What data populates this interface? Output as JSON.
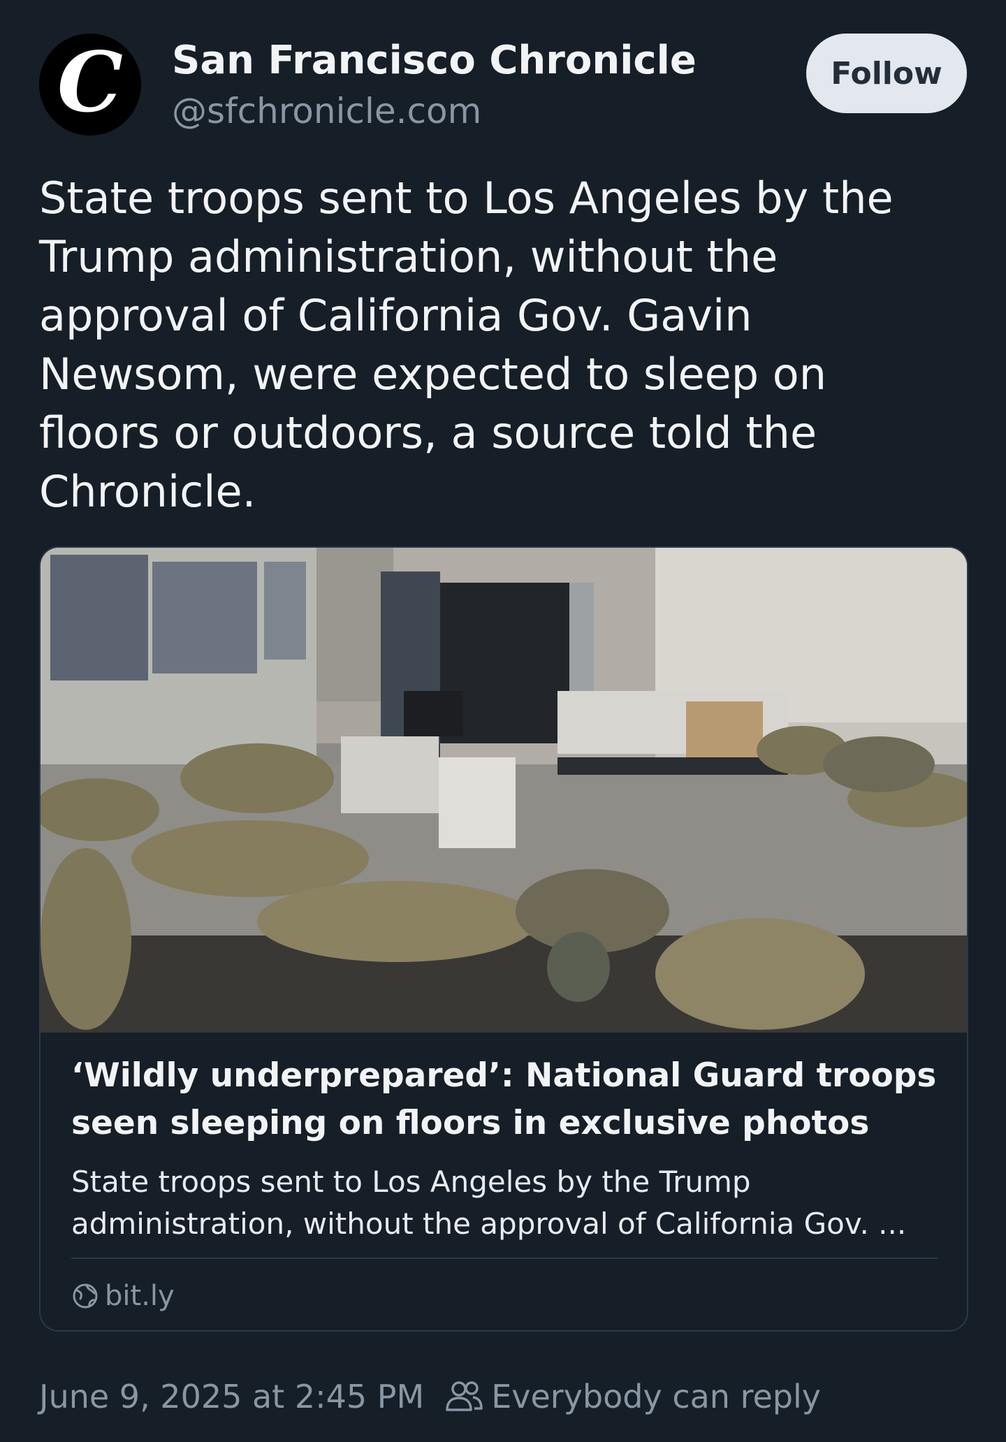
{
  "author": {
    "avatar_letter": "C",
    "display_name": "San Francisco Chronicle",
    "handle": "@sfchronicle.com"
  },
  "follow_label": "Follow",
  "post": {
    "text": "State troops sent to Los Angeles by the Trump administration, without the approval of California Gov. Gavin Newsom, were expected to sleep on floors or outdoors, a source told the Chronicle."
  },
  "link_card": {
    "title": "‘Wildly underprepared’: National Guard troops seen sleeping on floors in exclusive photos",
    "description": "State troops sent to Los Angeles by the Trump administration, without the approval of California Gov. ...",
    "source": "bit.ly",
    "source_icon": "globe-icon"
  },
  "footer": {
    "timestamp": "June 9, 2025 at 2:45 PM",
    "reply_icon": "people-icon",
    "reply_setting": "Everybody can reply"
  },
  "colors": {
    "background": "#161e27",
    "text_primary": "#f1f3f5",
    "text_secondary": "#8996a4",
    "follow_button_bg": "#e3e8ee",
    "card_border": "#2b3846"
  }
}
